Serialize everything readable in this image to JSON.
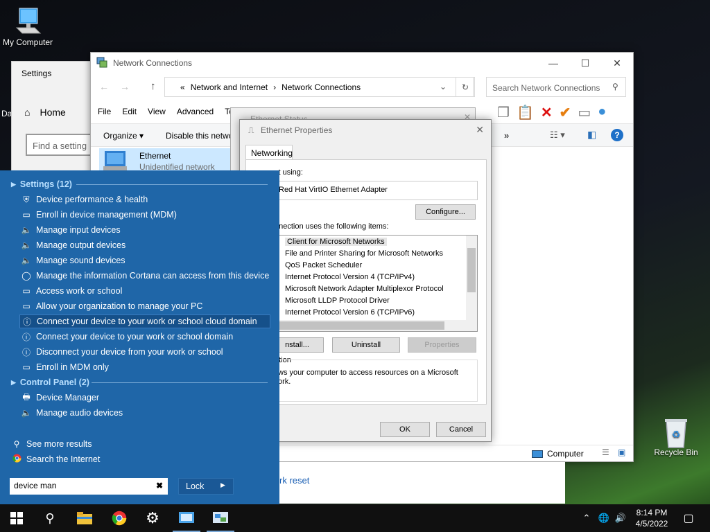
{
  "desktop": {
    "my_computer": "My Computer",
    "recycle_bin": "Recycle Bin",
    "partial_label": "Da"
  },
  "settings_window": {
    "title": "Settings",
    "home": "Home",
    "find_placeholder": "Find a setting"
  },
  "network_window": {
    "title": "Network Connections",
    "breadcrumb": [
      "Network and Internet",
      "Network Connections"
    ],
    "breadcrumb_prefix": "«",
    "search_placeholder": "Search Network Connections",
    "menu": [
      "File",
      "Edit",
      "View",
      "Advanced",
      "To"
    ],
    "organize": "Organize",
    "disable": "Disable this netwo",
    "adapter_name": "Ethernet",
    "adapter_status": "Unidentified network",
    "status_computer": "Computer",
    "more": "»"
  },
  "ethernet_status": {
    "title": "Ethernet Status"
  },
  "ethernet_properties": {
    "title": "Ethernet Properties",
    "tab": "Networking",
    "connect_using": "ct using:",
    "adapter": "Red Hat VirtIO Ethernet Adapter",
    "configure": "Configure...",
    "items_label": "nnection uses the following items:",
    "items": [
      "Client for Microsoft Networks",
      "File and Printer Sharing for Microsoft Networks",
      "QoS Packet Scheduler",
      "Internet Protocol Version 4 (TCP/IPv4)",
      "Microsoft Network Adapter Multiplexor Protocol",
      "Microsoft LLDP Protocol Driver",
      "Internet Protocol Version 6 (TCP/IPv6)"
    ],
    "install": "nstall...",
    "uninstall": "Uninstall",
    "properties": "Properties",
    "description_label": "ption",
    "description_text": "ws your computer to access resources on a Microsoft",
    "description_text2": "ork.",
    "ok": "OK",
    "cancel": "Cancel"
  },
  "start_menu": {
    "settings_header": "Settings (12)",
    "settings_items": [
      "Device performance & health",
      "Enroll in device management (MDM)",
      "Manage input devices",
      "Manage output devices",
      "Manage sound devices",
      "Manage the information Cortana can access from this device",
      "Access work or school",
      "Allow your organization to manage your PC",
      "Connect your device to your work or school cloud domain",
      "Connect your device to your work or school domain",
      "Disconnect your device from your work or school",
      "Enroll in MDM only"
    ],
    "control_panel_header": "Control Panel (2)",
    "control_panel_items": [
      "Device Manager",
      "Manage audio devices"
    ],
    "see_more": "See more results",
    "search_internet": "Search the Internet",
    "search_value": "device man",
    "lock": "Lock"
  },
  "background_window": {
    "link": "rk reset"
  },
  "taskbar": {
    "time": "8:14 PM",
    "date": "4/5/2022"
  }
}
